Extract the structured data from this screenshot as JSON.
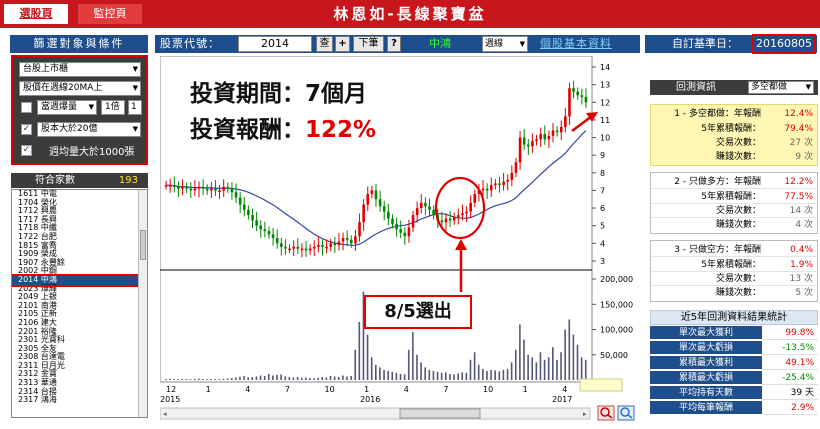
{
  "topbar": {
    "tab_active": "選股頁",
    "tab_monitor": "監控頁",
    "title": "林恩如-長線聚寶盆"
  },
  "left": {
    "header": "篩選對象與條件",
    "filters": {
      "market": "台股上市櫃",
      "ma_condition": "股價在週線20MA上",
      "volume_label": "當週爆量",
      "volume_multiplier": "1倍",
      "volume_extra": "1",
      "capital_condition": "股本大於20億",
      "avg_volume_label": "週均量大於1000張"
    },
    "count_label": "符合家數",
    "count_value": "193",
    "stocks": [
      "1611 中電",
      "1704 榮化",
      "1712 興農",
      "1717 長興",
      "1718 中纖",
      "1722 台肥",
      "1815 富喬",
      "1909 榮成",
      "1907 永豐餘",
      "2002 中鋼",
      "2014 中鴻",
      "2023 燁輝",
      "2049 上銀",
      "2101 南港",
      "2105 正新",
      "2106 建大",
      "2201 裕隆",
      "2301 光寶科",
      "2305 全友",
      "2308 台達電",
      "2311 日月光",
      "2312 金寶",
      "2313 華通",
      "2314 台揚",
      "2317 鴻海"
    ],
    "selected_index": 10
  },
  "toolbar": {
    "code_label": "股票代號：",
    "code_value": "2014",
    "check_btn": "查",
    "plus_btn": "+",
    "next_btn": "下筆",
    "help_btn": "?",
    "stock_name": "中鴻",
    "period": "週線",
    "link": "個股基本資料"
  },
  "overlay": {
    "period_text": "投資期間：7個月",
    "return_label": "投資報酬：",
    "return_value": "122%",
    "pick_label": "8/5選出"
  },
  "chart_data": {
    "type": "candlestick",
    "price_axis": {
      "ticks": [
        3,
        4,
        5,
        6,
        7,
        8,
        9,
        10,
        11,
        12,
        13,
        14
      ],
      "ylim": [
        2.6,
        14.4
      ]
    },
    "volume_axis": {
      "ticks": [
        "50,000",
        "100,000",
        "150,000",
        "200,000"
      ],
      "values": [
        50000,
        100000,
        150000,
        200000
      ],
      "ylim": [
        0,
        210000
      ]
    },
    "x_ticks": [
      "12",
      "1",
      "4",
      "7",
      "10",
      "1",
      "4",
      "7",
      "10",
      "1",
      "4"
    ],
    "year_labels": [
      "2015",
      "2016",
      "2017"
    ],
    "prices": [
      7.3,
      7.3,
      7.2,
      7.1,
      7.2,
      7.1,
      7.0,
      7.1,
      7.2,
      7.1,
      7.0,
      7.1,
      7.0,
      7.0,
      7.2,
      7.1,
      6.9,
      6.6,
      6.2,
      5.9,
      5.6,
      5.3,
      5.0,
      4.8,
      4.7,
      4.5,
      4.3,
      4.0,
      3.8,
      3.7,
      3.7,
      3.8,
      3.7,
      3.7,
      3.6,
      3.7,
      3.8,
      3.9,
      3.8,
      3.8,
      4.0,
      3.9,
      4.1,
      4.3,
      4.2,
      4.0,
      4.4,
      5.2,
      6.2,
      6.8,
      7.0,
      6.5,
      6.1,
      5.8,
      5.4,
      5.1,
      4.8,
      4.6,
      4.4,
      4.9,
      5.6,
      6.0,
      6.3,
      6.1,
      5.9,
      5.6,
      5.3,
      5.2,
      5.4,
      5.3,
      5.5,
      5.6,
      5.7,
      5.8,
      6.3,
      6.8,
      7.0,
      7.1,
      7.0,
      7.3,
      7.4,
      7.3,
      7.5,
      7.6,
      8.0,
      8.6,
      10.0,
      9.6,
      9.5,
      9.8,
      9.9,
      10.2,
      9.9,
      10.1,
      10.4,
      10.3,
      10.6,
      11.2,
      12.8,
      12.6,
      12.4,
      12.3,
      12.0
    ],
    "volumes": [
      2000,
      2500,
      1800,
      1500,
      2200,
      1900,
      1700,
      2100,
      2600,
      1800,
      1500,
      2000,
      1900,
      1700,
      2300,
      3000,
      4000,
      5000,
      6500,
      8000,
      5000,
      6000,
      7000,
      9000,
      8000,
      12000,
      9000,
      10000,
      11000,
      7000,
      6000,
      5000,
      6000,
      4500,
      5000,
      4000,
      3500,
      4500,
      6000,
      5000,
      8000,
      7000,
      6000,
      9000,
      7000,
      8000,
      60000,
      115000,
      175000,
      90000,
      45000,
      30000,
      25000,
      20000,
      18000,
      16000,
      14000,
      12000,
      11000,
      60000,
      95000,
      50000,
      35000,
      25000,
      20000,
      18000,
      16000,
      14000,
      15000,
      12000,
      11000,
      13000,
      15000,
      14000,
      40000,
      55000,
      30000,
      22000,
      18000,
      20000,
      19000,
      17000,
      20000,
      22000,
      35000,
      60000,
      110000,
      80000,
      50000,
      45000,
      35000,
      55000,
      40000,
      45000,
      65000,
      40000,
      55000,
      100000,
      120000,
      90000,
      70000,
      45000,
      40000
    ]
  },
  "right": {
    "base_label": "自訂基準日：",
    "base_value": "20160805",
    "backtest_label": "回測資訊",
    "backtest_mode": "多空都做",
    "groups": [
      {
        "title": "1 - 多空都做：年報酬",
        "annual": "12.4%",
        "rows": [
          {
            "k": "5年累積報酬：",
            "v": "79.4%"
          },
          {
            "k": "交易次數：",
            "v": "27 次"
          },
          {
            "k": "賺錢次數：",
            "v": "9 次"
          }
        ]
      },
      {
        "title": "2 - 只做多方：年報酬",
        "annual": "12.2%",
        "rows": [
          {
            "k": "5年累積報酬：",
            "v": "77.5%"
          },
          {
            "k": "交易次數：",
            "v": "14 次"
          },
          {
            "k": "賺錢次數：",
            "v": "4 次"
          }
        ]
      },
      {
        "title": "3 - 只做空方：年報酬",
        "annual": "0.4%",
        "rows": [
          {
            "k": "5年累積報酬：",
            "v": "1.9%"
          },
          {
            "k": "交易次數：",
            "v": "13 次"
          },
          {
            "k": "賺錢次數：",
            "v": "5 次"
          }
        ]
      }
    ],
    "stats_title": "近5年回測資料結果統計",
    "stats": [
      {
        "k": "單次最大獲利",
        "v": "99.8%"
      },
      {
        "k": "單次最大虧損",
        "v": "-13.5%"
      },
      {
        "k": "累積最大獲利",
        "v": "49.1%"
      },
      {
        "k": "累積最大虧損",
        "v": "-25.4%"
      },
      {
        "k": "平均持有天數",
        "v": "39 天"
      },
      {
        "k": "平均每筆報酬",
        "v": "2.9%"
      }
    ]
  }
}
